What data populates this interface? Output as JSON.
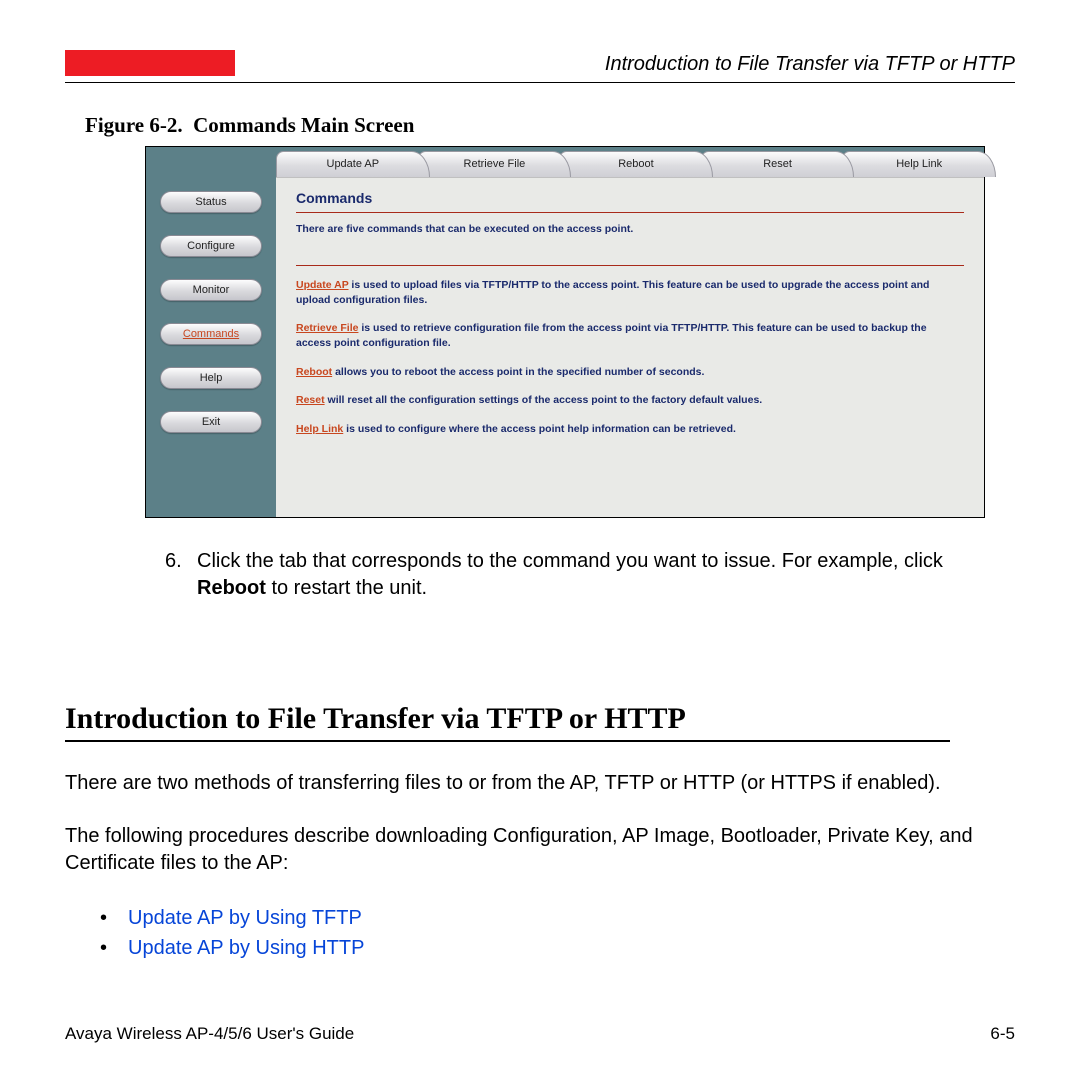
{
  "header": {
    "running_title": "Introduction to File Transfer via TFTP or HTTP"
  },
  "figure": {
    "caption_prefix": "Figure 6-2.",
    "caption_title": "Commands Main Screen",
    "sidebar": [
      {
        "label": "Status",
        "active": false
      },
      {
        "label": "Configure",
        "active": false
      },
      {
        "label": "Monitor",
        "active": false
      },
      {
        "label": "Commands",
        "active": true
      },
      {
        "label": "Help",
        "active": false
      },
      {
        "label": "Exit",
        "active": false
      }
    ],
    "tabs": [
      {
        "label": "Update AP"
      },
      {
        "label": "Retrieve File"
      },
      {
        "label": "Reboot"
      },
      {
        "label": "Reset"
      },
      {
        "label": "Help Link"
      }
    ],
    "panel": {
      "title": "Commands",
      "intro": "There are five commands that can be executed on the access point.",
      "items": [
        {
          "link": "Update AP",
          "rest": " is used to upload files via TFTP/HTTP to the access point. This feature can be used to upgrade the access point and upload configuration files."
        },
        {
          "link": "Retrieve File",
          "rest": " is used to retrieve configuration file from the access point via TFTP/HTTP. This feature can be used to backup the access point configuration file."
        },
        {
          "link": "Reboot",
          "rest": " allows you to reboot the access point in the specified number of seconds."
        },
        {
          "link": "Reset",
          "rest": " will reset all the configuration settings of the access point to the factory default values."
        },
        {
          "link": "Help Link",
          "rest": " is used to configure where the access point help information can be retrieved."
        }
      ]
    }
  },
  "step": {
    "number": "6.",
    "text_before": "Click the tab that corresponds to the command you want to issue. For example, click ",
    "bold": "Reboot",
    "text_after": " to restart the unit."
  },
  "section_heading": "Introduction to File Transfer via TFTP or HTTP",
  "para1": "There are two methods of transferring files to or from the AP, TFTP or HTTP (or HTTPS if enabled).",
  "para2": "The following procedures describe downloading Configuration, AP Image, Bootloader, Private Key, and Certificate files to the AP:",
  "bullets": [
    "Update AP by Using TFTP",
    "Update AP by Using HTTP"
  ],
  "footer": {
    "left": "Avaya Wireless AP-4/5/6 User's Guide",
    "right": "6-5"
  }
}
